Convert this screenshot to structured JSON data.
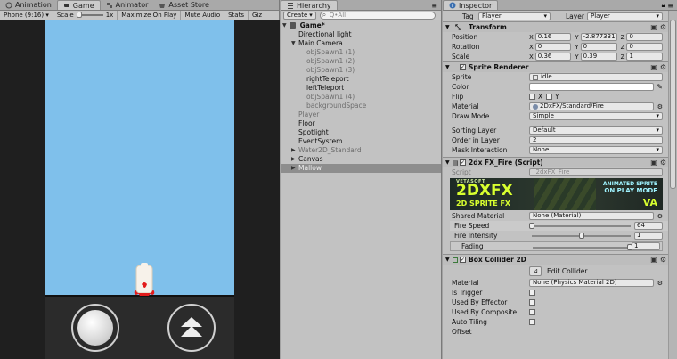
{
  "game_panel": {
    "tabs": [
      {
        "label": "Animation",
        "icon": "animation-icon"
      },
      {
        "label": "Game",
        "icon": "game-controller-icon"
      },
      {
        "label": "Animator",
        "icon": "animator-icon"
      },
      {
        "label": "Asset Store",
        "icon": "store-icon"
      }
    ],
    "toolbar": {
      "resolution": "Phone (9:16)",
      "scale_label": "Scale",
      "scale_value": "1x",
      "maximize_on_play": "Maximize On Play",
      "mute_audio": "Mute Audio",
      "stats": "Stats",
      "gizmos": "Giz"
    }
  },
  "hierarchy": {
    "tab_label": "Hierarchy",
    "create_label": "Create",
    "search_placeholder": "Q•All",
    "scene_name": "Game*",
    "items": [
      {
        "label": "Directional light",
        "indent": 1,
        "dim": false,
        "arrow": ""
      },
      {
        "label": "Main Camera",
        "indent": 1,
        "dim": false,
        "arrow": "▼"
      },
      {
        "label": "objSpawn1 (1)",
        "indent": 2,
        "dim": true,
        "arrow": ""
      },
      {
        "label": "objSpawn1 (2)",
        "indent": 2,
        "dim": true,
        "arrow": ""
      },
      {
        "label": "objSpawn1 (3)",
        "indent": 2,
        "dim": true,
        "arrow": ""
      },
      {
        "label": "rightTeleport",
        "indent": 2,
        "dim": false,
        "arrow": ""
      },
      {
        "label": "leftTeleport",
        "indent": 2,
        "dim": false,
        "arrow": ""
      },
      {
        "label": "objSpawn1 (4)",
        "indent": 2,
        "dim": true,
        "arrow": ""
      },
      {
        "label": "backgroundSpace",
        "indent": 2,
        "dim": true,
        "arrow": ""
      },
      {
        "label": "Player",
        "indent": 1,
        "dim": true,
        "arrow": ""
      },
      {
        "label": "Floor",
        "indent": 1,
        "dim": false,
        "arrow": ""
      },
      {
        "label": "Spotlight",
        "indent": 1,
        "dim": false,
        "arrow": ""
      },
      {
        "label": "EventSystem",
        "indent": 1,
        "dim": false,
        "arrow": ""
      },
      {
        "label": "Water2D_Standard",
        "indent": 1,
        "dim": true,
        "arrow": "▶"
      },
      {
        "label": "Canvas",
        "indent": 1,
        "dim": false,
        "arrow": "▶"
      },
      {
        "label": "Mallow",
        "indent": 1,
        "dim": false,
        "arrow": "▶",
        "selected": true
      }
    ]
  },
  "inspector": {
    "tab_label": "Inspector",
    "tag_label": "Tag",
    "tag_value": "Player",
    "layer_label": "Layer",
    "layer_value": "Player",
    "transform": {
      "title": "Transform",
      "position_label": "Position",
      "rotation_label": "Rotation",
      "scale_label": "Scale",
      "position": {
        "x": "0.16",
        "y": "-2.877331",
        "z": "0"
      },
      "rotation": {
        "x": "0",
        "y": "0",
        "z": "0"
      },
      "scale": {
        "x": "0.36",
        "y": "0.39",
        "z": "1"
      }
    },
    "sprite_renderer": {
      "title": "Sprite Renderer",
      "sprite_label": "Sprite",
      "sprite_value": "idle",
      "color_label": "Color",
      "flip_label": "Flip",
      "flip_x": "X",
      "flip_y": "Y",
      "material_label": "Material",
      "material_value": "2DxFX/Standard/Fire",
      "draw_mode_label": "Draw Mode",
      "draw_mode_value": "Simple",
      "sorting_layer_label": "Sorting Layer",
      "sorting_layer_value": "Default",
      "order_label": "Order in Layer",
      "order_value": "2",
      "mask_label": "Mask Interaction",
      "mask_value": "None"
    },
    "fx_fire": {
      "title": "2dx FX_Fire (Script)",
      "script_label": "Script",
      "script_value": "_2dxFX_Fire",
      "banner_brand_top": "VETASOFT",
      "banner_brand": "2DXFX",
      "banner_sub": "2D SPRITE FX",
      "banner_promo1": "ANIMATED SPRITE",
      "banner_promo2": "ON PLAY MODE",
      "banner_logo": "VA",
      "shared_material_label": "Shared Material",
      "shared_material_value": "None (Material)",
      "fire_speed_label": "Fire Speed",
      "fire_speed_value": "64",
      "fire_speed_fraction": 0.0,
      "fire_intensity_label": "Fire Intensity",
      "fire_intensity_value": "1",
      "fire_intensity_fraction": 0.5,
      "fading_label": "Fading",
      "fading_value": "1",
      "fading_fraction": 1.0
    },
    "box_collider": {
      "title": "Box Collider 2D",
      "edit_collider_label": "Edit Collider",
      "material_label": "Material",
      "material_value": "None (Physics Material 2D)",
      "is_trigger_label": "Is Trigger",
      "used_by_effector_label": "Used By Effector",
      "used_by_composite_label": "Used By Composite",
      "auto_tiling_label": "Auto Tiling",
      "offset_label": "Offset"
    }
  }
}
